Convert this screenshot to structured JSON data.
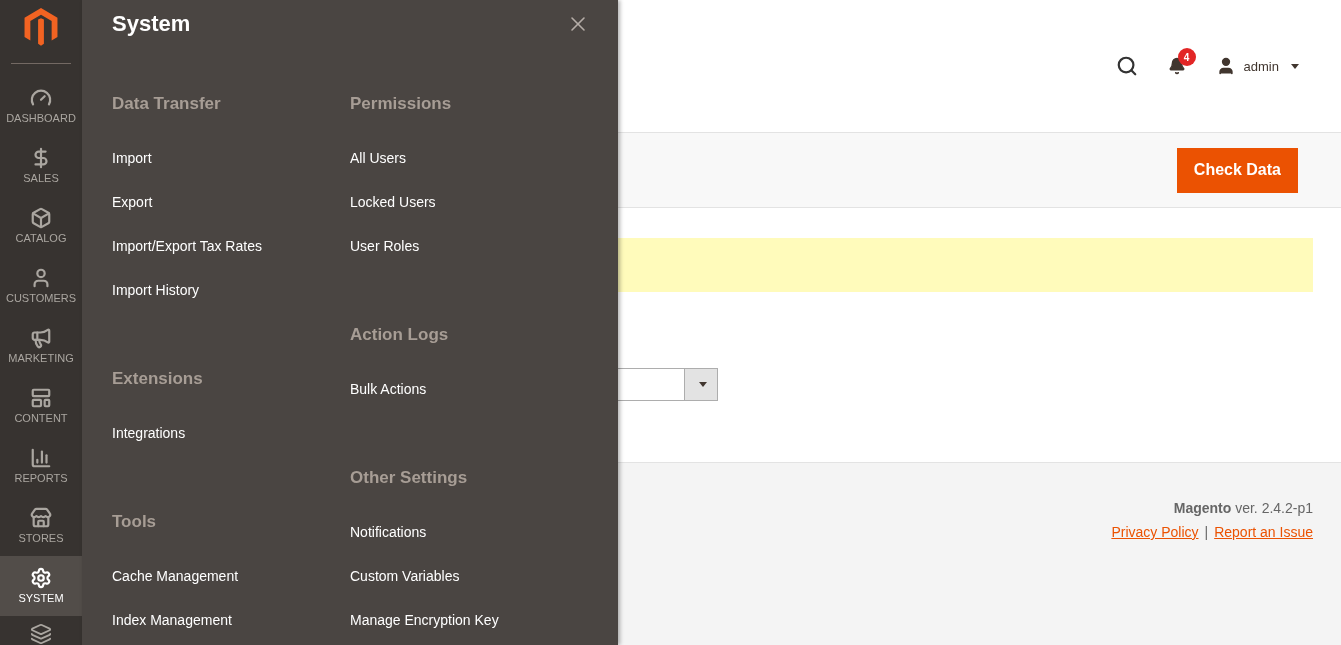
{
  "sidebar": {
    "items": [
      {
        "label": "DASHBOARD",
        "selected": false
      },
      {
        "label": "SALES",
        "selected": false
      },
      {
        "label": "CATALOG",
        "selected": false
      },
      {
        "label": "CUSTOMERS",
        "selected": false
      },
      {
        "label": "MARKETING",
        "selected": false
      },
      {
        "label": "CONTENT",
        "selected": false
      },
      {
        "label": "REPORTS",
        "selected": false
      },
      {
        "label": "STORES",
        "selected": false
      },
      {
        "label": "SYSTEM",
        "selected": true
      }
    ]
  },
  "flyout": {
    "title": "System",
    "columns": [
      [
        {
          "heading": "Data Transfer",
          "items": [
            "Import",
            "Export",
            "Import/Export Tax Rates",
            "Import History"
          ]
        },
        {
          "heading": "Extensions",
          "items": [
            "Integrations"
          ]
        },
        {
          "heading": "Tools",
          "items": [
            "Cache Management",
            "Index Management"
          ]
        }
      ],
      [
        {
          "heading": "Permissions",
          "items": [
            "All Users",
            "Locked Users",
            "User Roles"
          ]
        },
        {
          "heading": "Action Logs",
          "items": [
            "Bulk Actions"
          ]
        },
        {
          "heading": "Other Settings",
          "items": [
            "Notifications",
            "Custom Variables",
            "Manage Encryption Key"
          ]
        }
      ]
    ]
  },
  "header": {
    "notifications_count": "4",
    "user": "admin"
  },
  "actions": {
    "primary_button": "Check Data"
  },
  "footer": {
    "brand": "Magento",
    "version": "ver. 2.4.2-p1",
    "links": [
      "Privacy Policy",
      "Report an Issue"
    ],
    "separator": "|"
  }
}
